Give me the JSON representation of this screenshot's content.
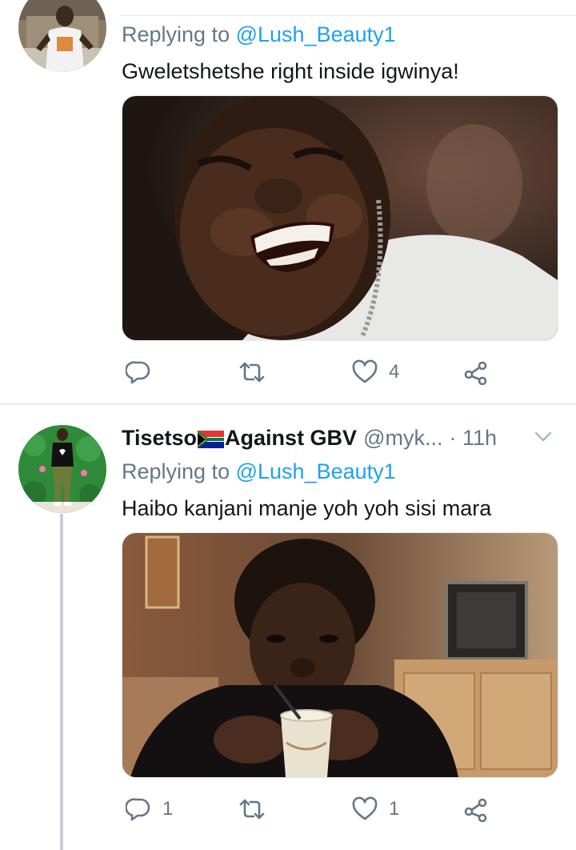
{
  "tweets": [
    {
      "replying_prefix": "Replying to",
      "replying_handle": "@Lush_Beauty1",
      "text": "Gweletshetshe right inside igwinya!",
      "actions": {
        "reply_count": "",
        "retweet_count": "",
        "like_count": "4"
      }
    },
    {
      "display_name_part1": "Tisetso",
      "display_name_part2": "Against GBV",
      "handle": "@myk...",
      "time": "· 11h",
      "replying_prefix": "Replying to",
      "replying_handle": "@Lush_Beauty1",
      "text": "Haibo kanjani manje yoh yoh sisi mara",
      "actions": {
        "reply_count": "1",
        "retweet_count": "",
        "like_count": "1"
      }
    }
  ],
  "icons": {
    "reply": "reply-icon",
    "retweet": "retweet-icon",
    "like": "heart-icon",
    "share": "share-icon",
    "more": "chevron-down-icon",
    "flag": "south-africa-flag-icon"
  },
  "colors": {
    "secondary_text": "#657786",
    "link": "#1da1f2",
    "divider": "#e6ecf0",
    "thread_line": "#c4cfd6"
  }
}
